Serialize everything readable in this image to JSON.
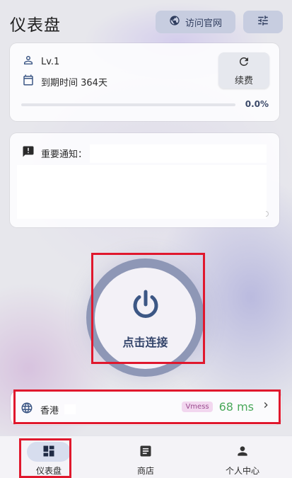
{
  "header": {
    "title": "仪表盘",
    "visit_site_label": "访问官网"
  },
  "account": {
    "level": "Lv.1",
    "expiry": "到期时间 364天",
    "renew_label": "续费",
    "usage_percent": "0.0%",
    "usage_fraction": 0.0
  },
  "notice": {
    "title": "重要通知："
  },
  "connect": {
    "label": "点击连接"
  },
  "node": {
    "name": "香港",
    "protocol": "Vmess",
    "latency": "68 ms"
  },
  "nav": {
    "items": [
      {
        "label": "仪表盘",
        "icon": "dashboard-icon",
        "active": true
      },
      {
        "label": "商店",
        "icon": "shop-icon",
        "active": false
      },
      {
        "label": "个人中心",
        "icon": "person-icon",
        "active": false
      }
    ]
  },
  "colors": {
    "accent": "#3c5785",
    "latency_green": "#49a85a",
    "highlight_red": "#e0182d",
    "badge_bg": "#f2d7ef"
  }
}
